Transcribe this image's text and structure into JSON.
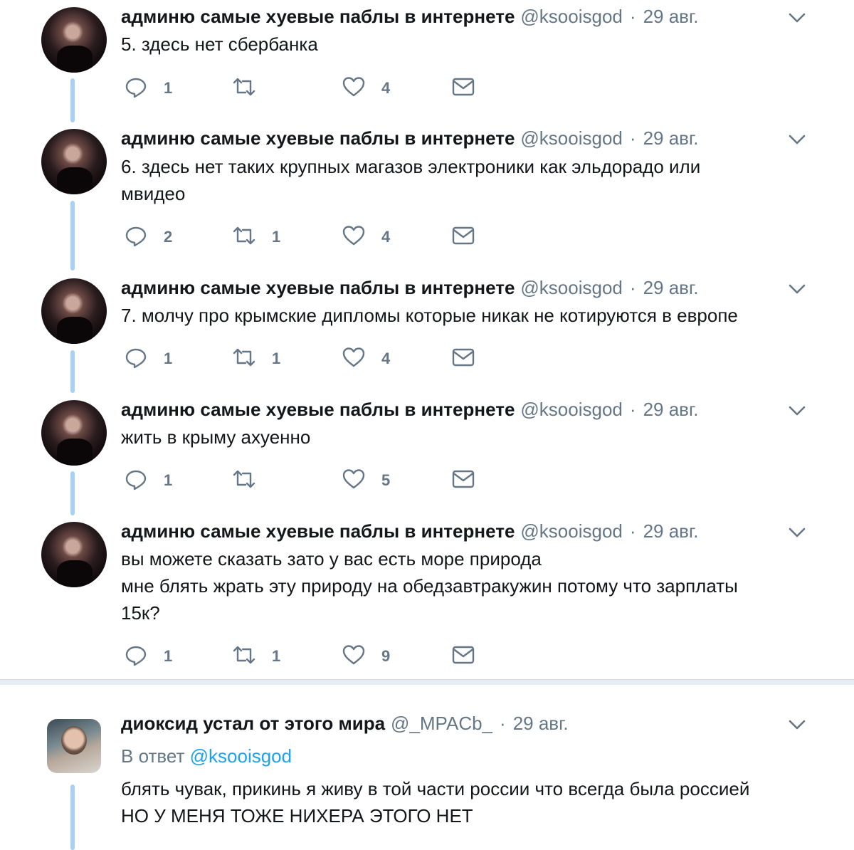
{
  "tweets": [
    {
      "name": "админю самые хуевые паблы в интернете",
      "handle": "@ksooisgod",
      "dot": "·",
      "date": "29 авг.",
      "lines": [
        "5. здесь нет сбербанка"
      ],
      "replies": "1",
      "retweets": "",
      "likes": "4"
    },
    {
      "name": "админю самые хуевые паблы в интернете",
      "handle": "@ksooisgod",
      "dot": "·",
      "date": "29 авг.",
      "lines": [
        "6. здесь нет таких крупных магазов электроники как эльдорадо или",
        "мвидео"
      ],
      "replies": "2",
      "retweets": "1",
      "likes": "4"
    },
    {
      "name": "админю самые хуевые паблы в интернете",
      "handle": "@ksooisgod",
      "dot": "·",
      "date": "29 авг.",
      "lines": [
        "7. молчу про крымские дипломы которые никак не котируются в европе"
      ],
      "replies": "1",
      "retweets": "1",
      "likes": "4"
    },
    {
      "name": "админю самые хуевые паблы в интернете",
      "handle": "@ksooisgod",
      "dot": "·",
      "date": "29 авг.",
      "lines": [
        "жить в крыму ахуенно"
      ],
      "replies": "1",
      "retweets": "",
      "likes": "5"
    },
    {
      "name": "админю самые хуевые паблы в интернете",
      "handle": "@ksooisgod",
      "dot": "·",
      "date": "29 авг.",
      "lines": [
        "вы можете сказать зато у вас есть море природа",
        "мне блять жрать эту природу на обедзавтракужин потому что зарплаты",
        "15к?"
      ],
      "replies": "1",
      "retweets": "1",
      "likes": "9"
    },
    {
      "name": "диоксид устал от этого мира",
      "handle": "@_MPACb_",
      "dot": "·",
      "date": "29 авг.",
      "reply_prefix": "В ответ",
      "reply_mention": "@ksooisgod",
      "lines": [
        "блять чувак, прикинь я живу в той части россии что всегда была россией",
        "НО У МЕНЯ ТОЖЕ НИХЕРА ЭТОГО НЕТ"
      ]
    }
  ],
  "icons": {
    "reply": "reply-icon",
    "retweet": "retweet-icon",
    "like": "heart-icon",
    "dm": "envelope-icon",
    "more": "chevron-down-icon"
  },
  "colors": {
    "name": "#14171a",
    "secondary": "#657786",
    "link": "#1da1f2",
    "thread_line": "#a8d2f5",
    "divider": "#e6ecf0"
  }
}
